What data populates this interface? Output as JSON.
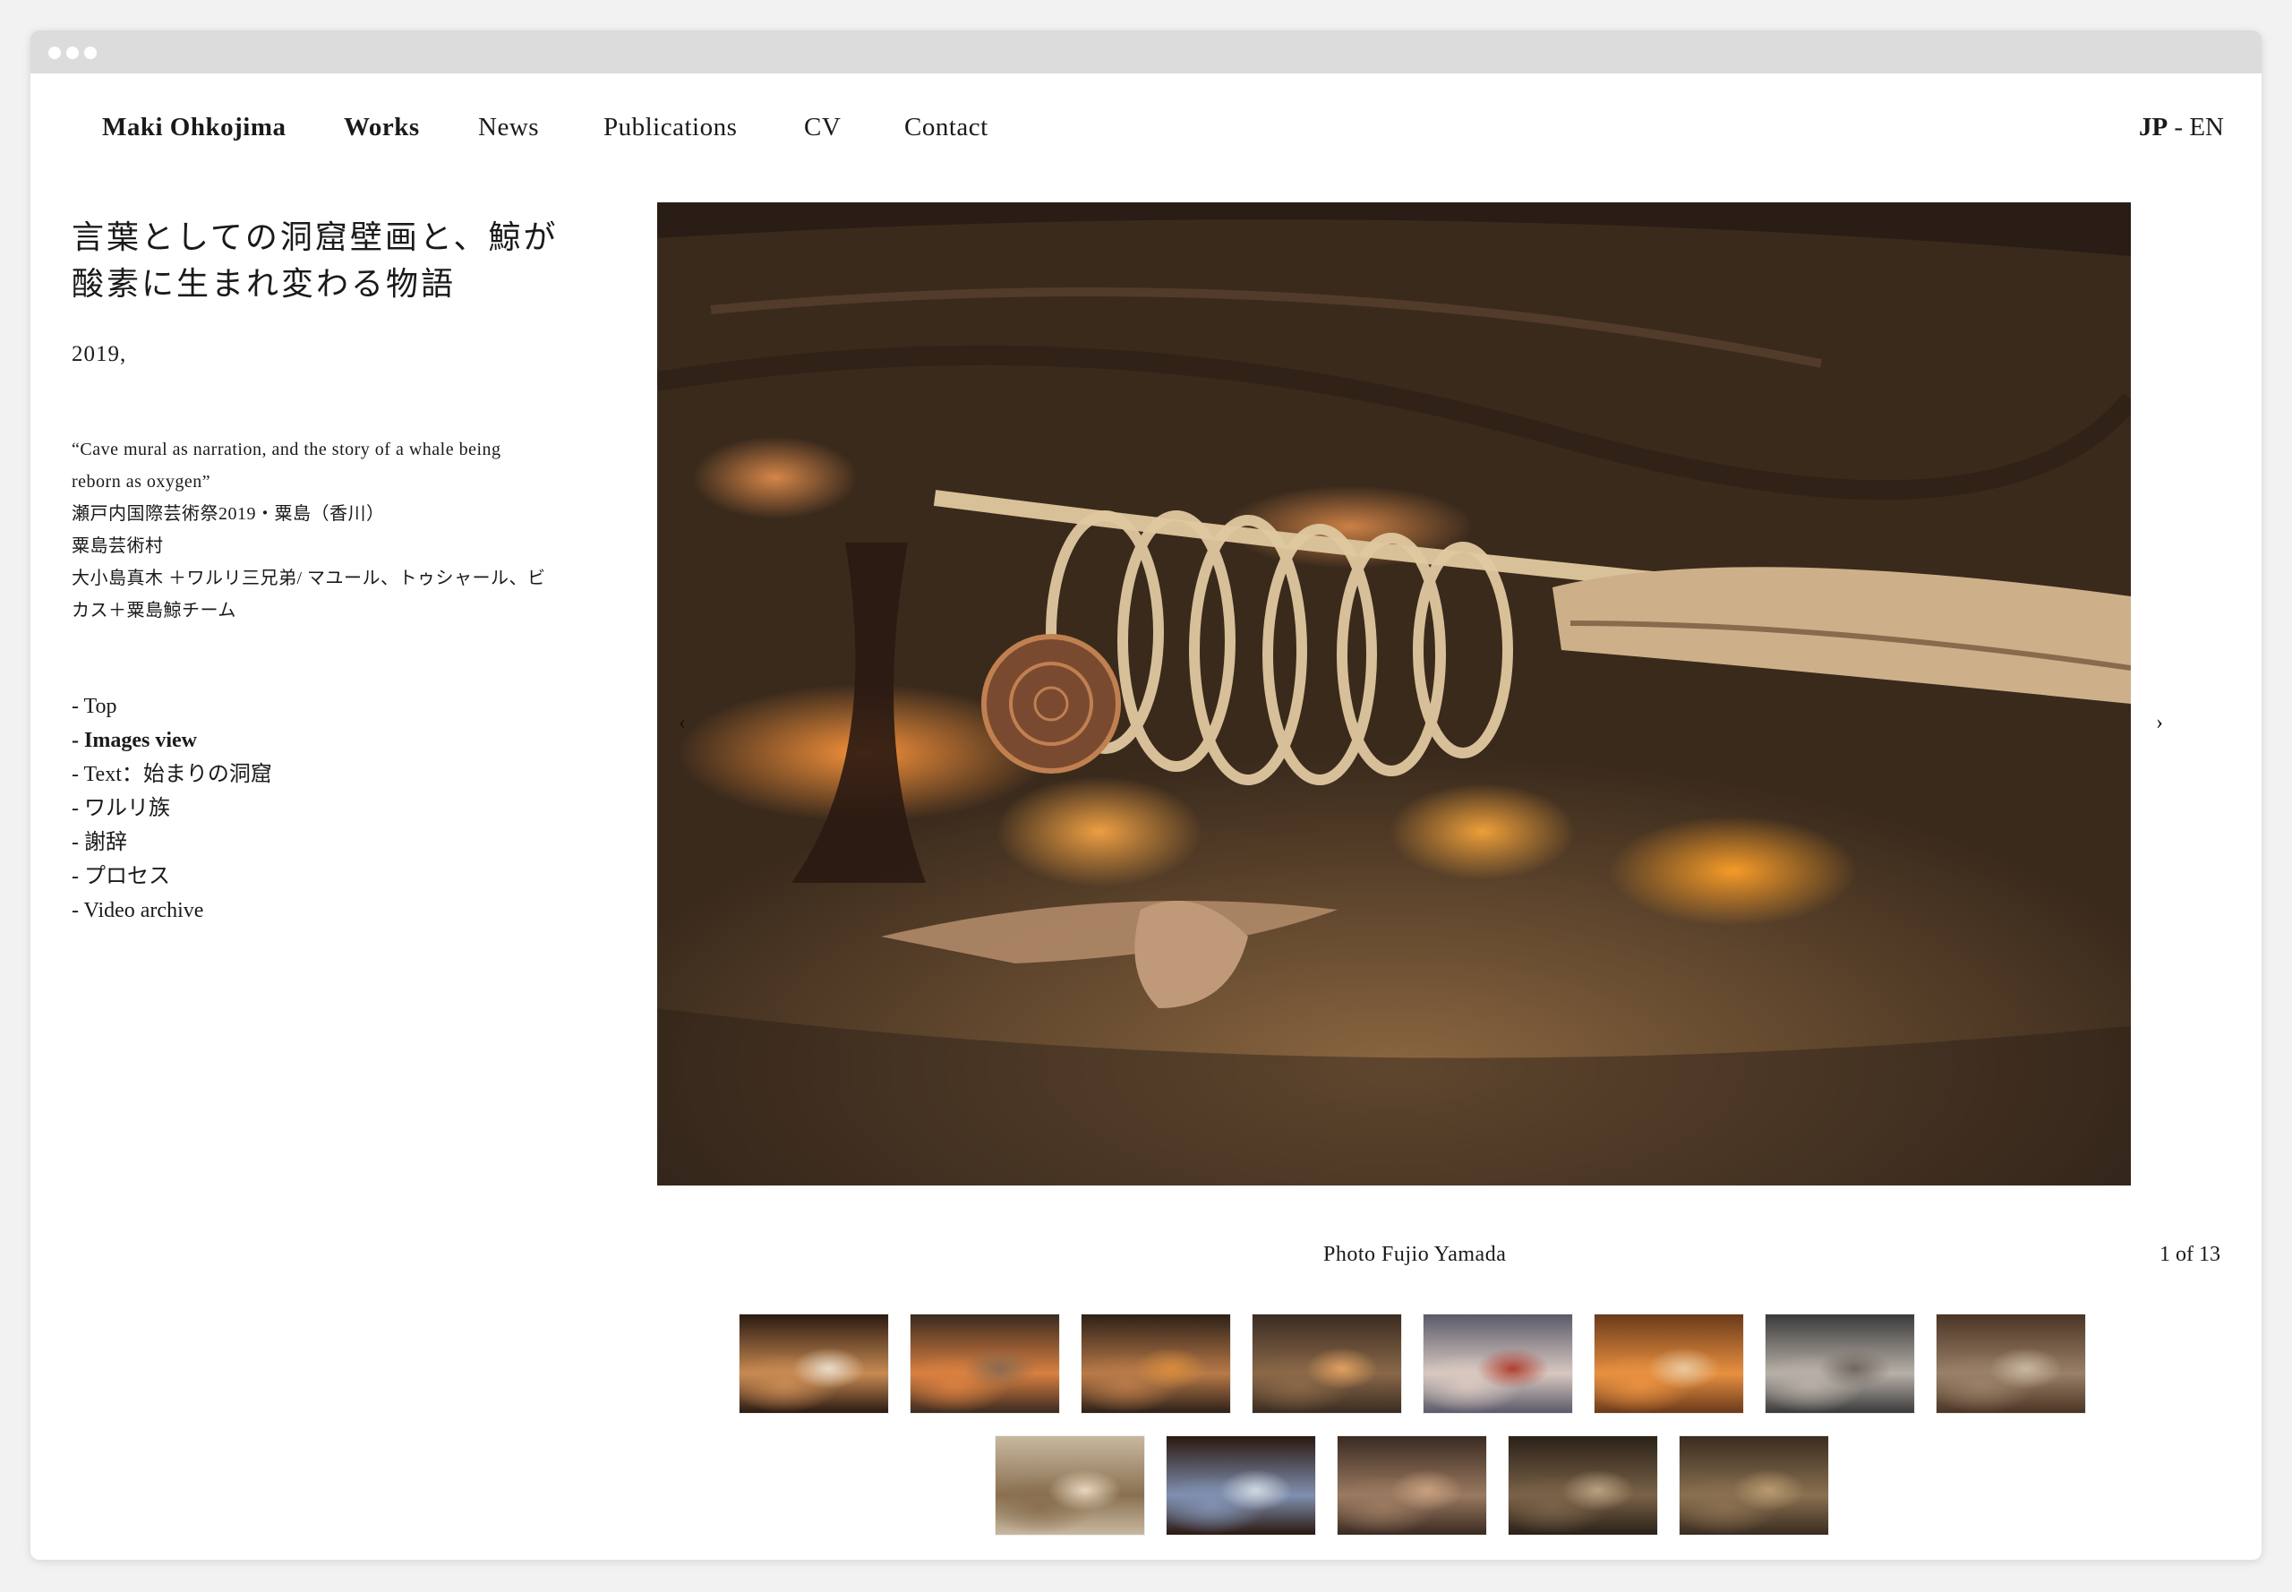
{
  "site": {
    "name": "Maki Ohkojima"
  },
  "nav": {
    "items": [
      {
        "label": "Works",
        "active": true
      },
      {
        "label": "News"
      },
      {
        "label": "Publications"
      },
      {
        "label": "CV"
      },
      {
        "label": "Contact"
      }
    ]
  },
  "lang": {
    "jp": "JP",
    "sep": " - ",
    "en": "EN",
    "active": "JP"
  },
  "work": {
    "title_line1": "言葉としての洞窟壁画と、鯨が",
    "title_line2": "酸素に生まれ変わる物語",
    "year": "2019,",
    "desc_lines": [
      "“Cave mural as narration, and the story of a whale being",
      "reborn as oxygen”",
      "瀬戸内国際芸術祭2019・粟島（香川）",
      "粟島芸術村",
      "大小島真木 ＋ワルリ三兄弟/ マユール、トゥシャール、ビ",
      "カス＋粟島鯨チーム"
    ]
  },
  "side_links": [
    {
      "label": "- Top"
    },
    {
      "label": "- Images view",
      "active": true
    },
    {
      "label": "- Text：始まりの洞窟"
    },
    {
      "label": "- ワルリ族"
    },
    {
      "label": "- 謝辞"
    },
    {
      "label": "- プロセス"
    },
    {
      "label": "- Video archive"
    }
  ],
  "viewer": {
    "prev_icon": "‹",
    "next_icon": "›",
    "caption": "Photo Fujio Yamada",
    "counter": "1 of 13",
    "current": 1,
    "total": 13
  },
  "thumbnails": [
    {
      "name": "thumb-1",
      "colors": [
        "#2a1a12",
        "#c88a52",
        "#e8dccb"
      ]
    },
    {
      "name": "thumb-2",
      "colors": [
        "#3a2a20",
        "#d98040",
        "#8a6a50"
      ]
    },
    {
      "name": "thumb-3",
      "colors": [
        "#2d2018",
        "#b87a48",
        "#d88c3c"
      ]
    },
    {
      "name": "thumb-4",
      "colors": [
        "#3a2c22",
        "#8a6848",
        "#e0a060"
      ]
    },
    {
      "name": "thumb-5",
      "colors": [
        "#5a5a6a",
        "#d8c8c0",
        "#b04030"
      ]
    },
    {
      "name": "thumb-6",
      "colors": [
        "#6a3a1a",
        "#e89040",
        "#e8c8a0"
      ]
    },
    {
      "name": "thumb-7",
      "colors": [
        "#3a3a3a",
        "#b8b0a8",
        "#706860"
      ]
    },
    {
      "name": "thumb-8",
      "colors": [
        "#4a3424",
        "#9a8068",
        "#c8b8a0"
      ]
    },
    {
      "name": "thumb-9",
      "colors": [
        "#c8b8a0",
        "#8a7050",
        "#e8d8c0"
      ]
    },
    {
      "name": "thumb-10",
      "colors": [
        "#2a1810",
        "#8090b0",
        "#d0d8e0"
      ]
    },
    {
      "name": "thumb-11",
      "colors": [
        "#3a2a22",
        "#9a7a60",
        "#c8a080"
      ]
    },
    {
      "name": "thumb-12",
      "colors": [
        "#2a2018",
        "#7a6248",
        "#b8a080"
      ]
    },
    {
      "name": "thumb-13",
      "colors": [
        "#3a2c20",
        "#8a7050",
        "#b89a70"
      ]
    }
  ]
}
